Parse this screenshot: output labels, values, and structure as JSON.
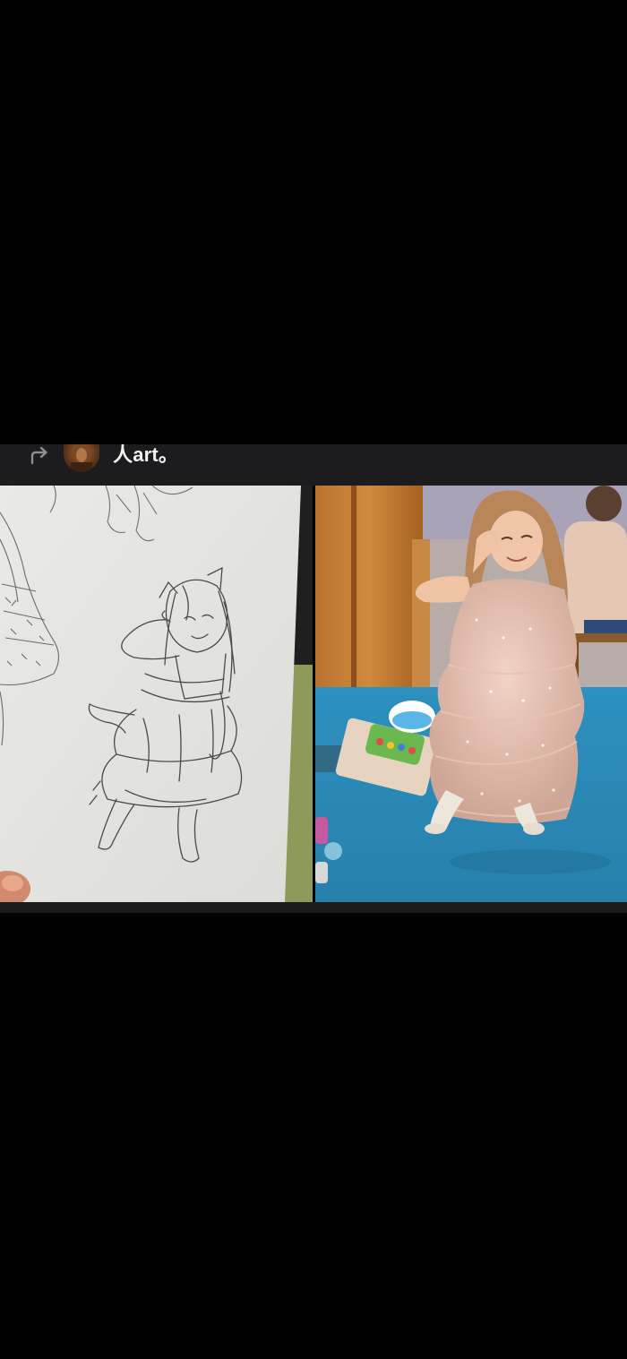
{
  "post": {
    "author_name": "人art。",
    "icons": {
      "repost": "repost-icon",
      "avatar": "avatar"
    }
  },
  "gallery": {
    "images": [
      {
        "name": "pencil-sketch-image",
        "kind": "pencil sketch"
      },
      {
        "name": "reference-photo-image",
        "kind": "photo"
      }
    ]
  },
  "colors": {
    "background": "#000000",
    "header_bar": "#1c1c1e",
    "header_text": "#f2f2f2",
    "icon_gray": "#8e8e93"
  }
}
